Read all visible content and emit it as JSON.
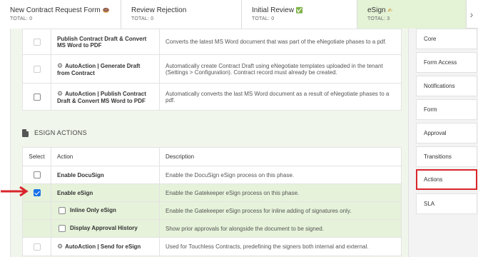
{
  "tabs": [
    {
      "name": "New Contract Request Form",
      "emoji": "🍩",
      "total": "TOTAL: 0",
      "active": false
    },
    {
      "name": "Review Rejection",
      "emoji": "",
      "total": "TOTAL: 0",
      "active": false
    },
    {
      "name": "Initial Review",
      "emoji": "✅",
      "total": "TOTAL: 0",
      "active": false
    },
    {
      "name": "eSign",
      "emoji": "✍",
      "total": "TOTAL: 3",
      "active": true
    }
  ],
  "top_table": {
    "rows": [
      {
        "checked": false,
        "name": "Publish Contract Draft & Convert MS Word to PDF",
        "auto": false,
        "description": "Converts the latest MS Word document that was part of the eNegotiate phases to a pdf."
      },
      {
        "checked": false,
        "name": "AutoAction | Generate Draft from Contract",
        "auto": true,
        "description": "Automatically create Contract Draft using eNegotiate templates uploaded in the tenant (Settings > Configuration). Contract record must already be created."
      },
      {
        "checked": false,
        "name": "AutoAction | Publish Contract Draft & Convert MS Word to PDF",
        "auto": true,
        "description": "Automatically converts the last MS Word document as a result of eNegotiate phases to a pdf."
      }
    ]
  },
  "esign_section": {
    "title": "ESIGN ACTIONS",
    "headers": {
      "select": "Select",
      "action": "Action",
      "description": "Description"
    },
    "rows": [
      {
        "checked": false,
        "name": "Enable DocuSign",
        "description": "Enable the DocuSign eSign process on this phase."
      },
      {
        "checked": true,
        "name": "Enable eSign",
        "description": "Enable the Gatekeeper eSign process on this phase."
      },
      {
        "checked": false,
        "name": "Inline Only eSign",
        "description": "Enable the Gatekeeper eSign process for inline adding of signatures only."
      },
      {
        "checked": false,
        "name": "Display Approval History",
        "description": "Show prior approvals for alongside the document to be signed."
      },
      {
        "checked": false,
        "name": "AutoAction | Send for eSign",
        "description": "Used for Touchless Contracts, predefining the signers both internal and external."
      }
    ]
  },
  "sidebar": {
    "items": [
      "Core",
      "Form Access",
      "Notifications",
      "Form",
      "Approval",
      "Transitions",
      "Actions",
      "SLA"
    ],
    "selected": "Actions"
  },
  "colors": {
    "accent": "#1a73e8",
    "highlight": "#e6f2da",
    "callout": "#d9262c",
    "active_tab": "#e4f2d6"
  },
  "icons": [
    "chevron-left-icon",
    "chevron-right-icon",
    "gear-icon",
    "document-icon",
    "arrow-right-icon"
  ]
}
